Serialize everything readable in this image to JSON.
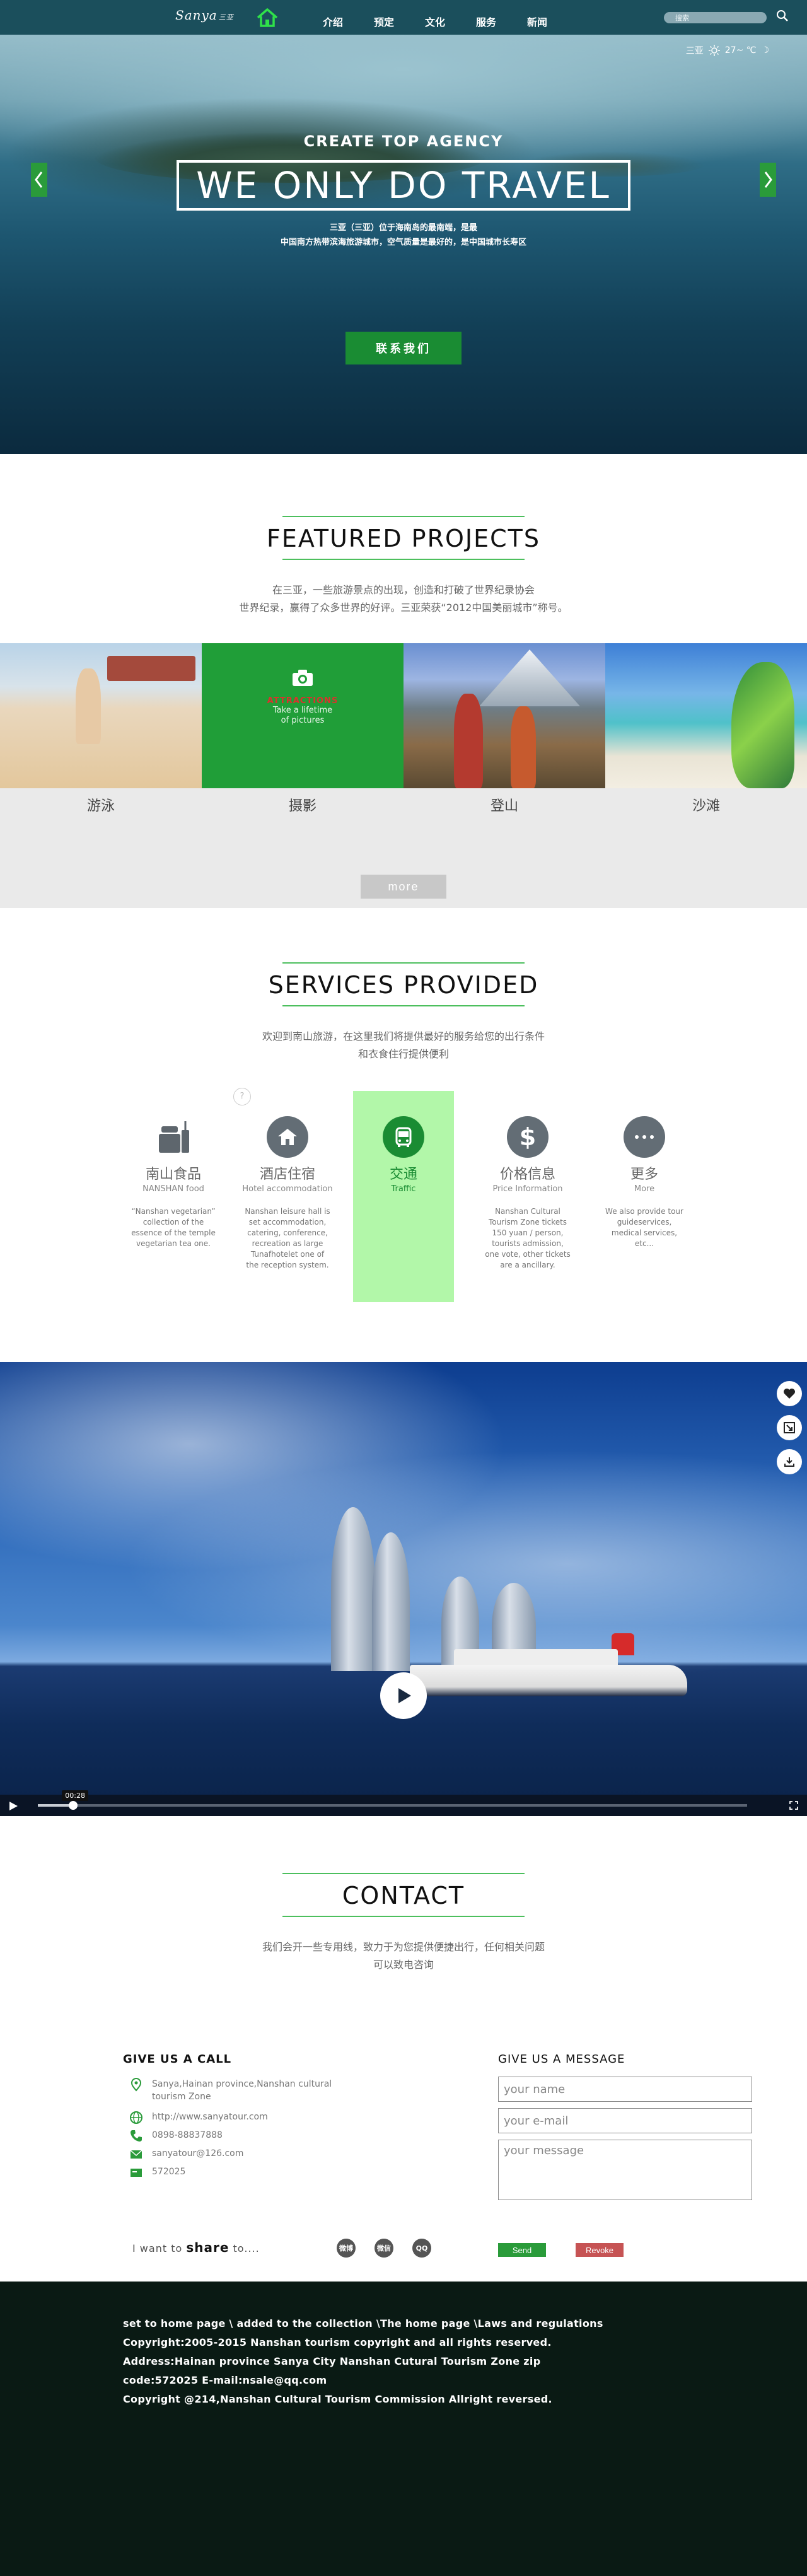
{
  "nav": {
    "logo": "Sanya",
    "logo_suffix": "三亚",
    "items": [
      "介绍",
      "预定",
      "文化",
      "服务",
      "新闻"
    ],
    "search_placeholder": "搜索"
  },
  "hero": {
    "weather_city": "三亚",
    "weather_temp": "27~ ℃",
    "subtitle": "CREATE TOP AGENCY",
    "title": "WE ONLY DO TRAVEL",
    "desc_line1": "三亚（三亚）位于海南岛的最南端，是最",
    "desc_line2": "中国南方热带滨海旅游城市，空气质量是最好的，是中国城市长寿区",
    "button": "联系我们"
  },
  "featured": {
    "title": "FEATURED PROJECTS",
    "desc_line1": "在三亚，一些旅游景点的出现，创造和打破了世界纪录协会",
    "desc_line2": "世界纪录，赢得了众多世界的好评。三亚荣获“2012中国美丽城市”称号。",
    "items": [
      {
        "label": "游泳"
      },
      {
        "label": "摄影",
        "overlay_red": "ATTRACTIONS",
        "overlay_line1": "Take a lifetime",
        "overlay_line2": "of pictures"
      },
      {
        "label": "登山"
      },
      {
        "label": "沙滩"
      }
    ],
    "more": "more"
  },
  "services": {
    "title": "SERVICES PROVIDED",
    "desc_line1": "欢迎到南山旅游，在这里我们将提供最好的服务给您的出行条件",
    "desc_line2": "和衣食住行提供便利",
    "tiny_icon": "?",
    "items": [
      {
        "cn": "南山食品",
        "en": "NANSHAN food",
        "text": "“Nanshan vegetarian” collection of the essence of the temple vegetarian tea one."
      },
      {
        "cn": "酒店住宿",
        "en": "Hotel accommodation",
        "text": "Nanshan leisure hall is set accommodation, catering, conference, recreation as large Tunafhotelet one of the reception system."
      },
      {
        "cn": "交通",
        "en": "Traffic",
        "text": ""
      },
      {
        "cn": "价格信息",
        "en": "Price Information",
        "text": "Nanshan Cultural Tourism Zone tickets 150 yuan / person, tourists admission, one vote, other tickets are a ancillary."
      },
      {
        "cn": "更多",
        "en": "More",
        "text": "We also provide tour guideservices, medical services, etc..."
      }
    ]
  },
  "video": {
    "time": "00:28",
    "progress": 0.05
  },
  "contact": {
    "title": "CONTACT",
    "desc_line1": "我们会开一些专用线，致力于为您提供便捷出行，任何相关问题",
    "desc_line2": "可以致电咨询",
    "call_title": "GIVE US A CALL",
    "address": "Sanya,Hainan province,Nanshan cultural tourism Zone",
    "website": "http://www.sanyatour.com",
    "phone": "0898-88837888",
    "email": "sanyatour@126.com",
    "zip": "572025",
    "msg_title": "GIVE US A MESSAGE",
    "name_placeholder": "your name",
    "email_placeholder": "your e-mail",
    "message_placeholder": "your message",
    "send": "Send",
    "revoke": "Revoke",
    "share_prefix": "I  want to",
    "share_bold": "share",
    "share_suffix": "to....",
    "share_icons": [
      "微博",
      "微信",
      "QQ"
    ]
  },
  "footer": {
    "line1": "set to home page \\ added to the collection \\The home page \\Laws and regulations",
    "line2": "Copyright:2005-2015 Nanshan tourism copyright and all rights reserved.",
    "line3": "Address:Hainan province Sanya City Nanshan Cutural Tourism Zone zip",
    "line4": "code:572025 E-mail:nsale@qq.com",
    "line5": "Copyright @214,Nanshan Cultural Tourism Commission Allright reversed."
  },
  "colors": {
    "accent_green": "#1a8c33",
    "nav_bg": "#1b4f5c",
    "footer_bg": "#0a1a14"
  }
}
